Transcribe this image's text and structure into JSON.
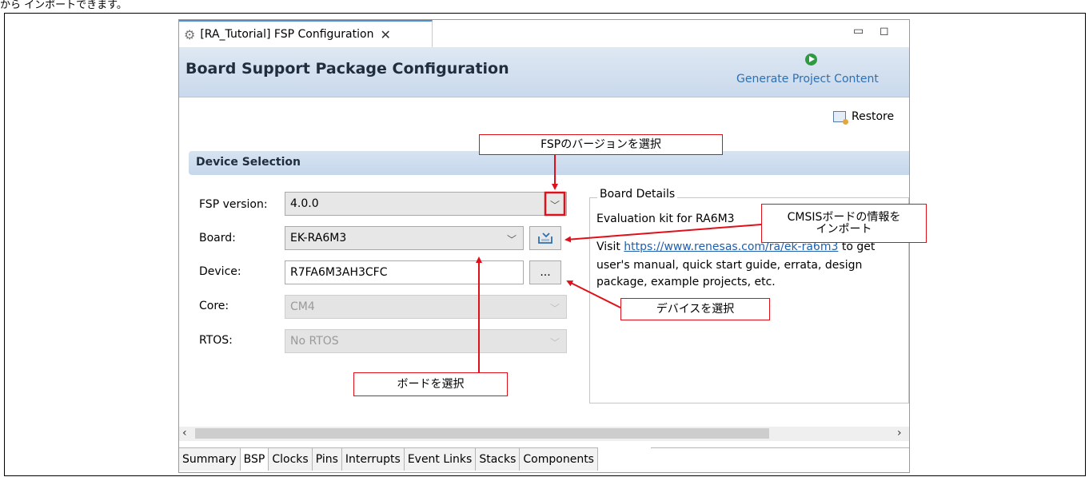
{
  "top_text": "から インポートできます。",
  "tab": {
    "title": "[RA_Tutorial] FSP Configuration"
  },
  "header": {
    "title": "Board Support Package Configuration",
    "generate_label": "Generate Project Content"
  },
  "restore_label": "Restore",
  "section_title": "Device Selection",
  "form": {
    "fsp_label": "FSP version:",
    "fsp_value": "4.0.0",
    "board_label": "Board:",
    "board_value": "EK-RA6M3",
    "device_label": "Device:",
    "device_value": "R7FA6M3AH3CFC",
    "device_btn": "...",
    "core_label": "Core:",
    "core_value": "CM4",
    "rtos_label": "RTOS:",
    "rtos_value": "No RTOS"
  },
  "board_details": {
    "title": "Board Details",
    "line1": "Evaluation kit for RA6M3",
    "visit": "Visit ",
    "url": "https://www.renesas.com/ra/ek-ra6m3",
    "after_url": " to get",
    "line3": "user's manual, quick start guide, errata, design",
    "line4": "package, example projects, etc."
  },
  "bottom_tabs": [
    "Summary",
    "BSP",
    "Clocks",
    "Pins",
    "Interrupts",
    "Event Links",
    "Stacks",
    "Components"
  ],
  "selected_tab": "BSP",
  "callouts": {
    "fsp": "FSPのバージョンを選択",
    "cmsis_line1": "CMSISボードの情報を",
    "cmsis_line2": "インポート",
    "device": "デバイスを選択",
    "board": "ボードを選択"
  },
  "colors": {
    "callout_red": "#e0101a",
    "header_blue": "#c9d9ec",
    "link_blue": "#1f5fae"
  }
}
